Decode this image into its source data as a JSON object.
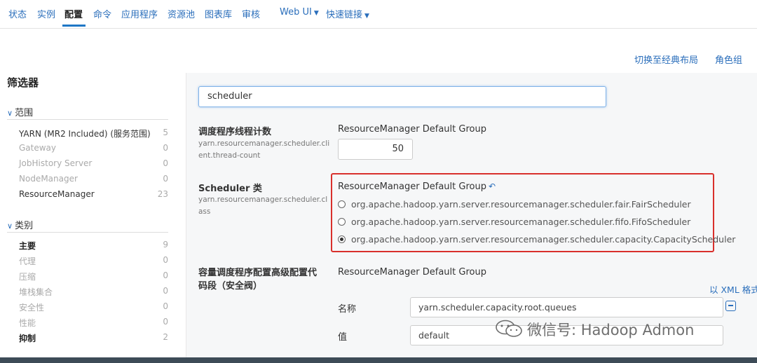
{
  "nav": {
    "items": [
      "状态",
      "实例",
      "配置",
      "命令",
      "应用程序",
      "资源池",
      "图表库",
      "审核"
    ],
    "webui": "Web UI",
    "quicklinks": "快速链接"
  },
  "toplinks": {
    "classic": "切换至经典布局",
    "role_groups": "角色组"
  },
  "sidebar": {
    "title": "筛选器",
    "scope": {
      "label": "范围",
      "items": [
        {
          "label": "YARN (MR2 Included) (服务范围)",
          "count": "5"
        },
        {
          "label": "Gateway",
          "count": "0"
        },
        {
          "label": "JobHistory Server",
          "count": "0"
        },
        {
          "label": "NodeManager",
          "count": "0"
        },
        {
          "label": "ResourceManager",
          "count": "23"
        }
      ]
    },
    "category": {
      "label": "类别",
      "items": [
        {
          "label": "主要",
          "count": "9"
        },
        {
          "label": "代理",
          "count": "0"
        },
        {
          "label": "压缩",
          "count": "0"
        },
        {
          "label": "堆栈集合",
          "count": "0"
        },
        {
          "label": "安全性",
          "count": "0"
        },
        {
          "label": "性能",
          "count": "0"
        },
        {
          "label": "抑制",
          "count": "2"
        }
      ]
    }
  },
  "search": {
    "value": "scheduler"
  },
  "properties": {
    "thread_count": {
      "label": "调度程序线程计数",
      "key_line1": "yarn.resourcemanager.scheduler.cli",
      "key_line2": "ent.thread-count",
      "group": "ResourceManager Default Group",
      "value": "50"
    },
    "scheduler_class": {
      "label": "Scheduler 类",
      "key_line1": "yarn.resourcemanager.scheduler.cl",
      "key_line2": "ass",
      "group": "ResourceManager Default Group",
      "options": [
        "org.apache.hadoop.yarn.server.resourcemanager.scheduler.fair.FairScheduler",
        "org.apache.hadoop.yarn.server.resourcemanager.scheduler.fifo.FifoScheduler",
        "org.apache.hadoop.yarn.server.resourcemanager.scheduler.capacity.CapacityScheduler"
      ],
      "selected": "org.apache.hadoop.yarn.server.resourcemanager.scheduler.capacity.CapacityScheduler"
    },
    "capacity_snippet": {
      "label_line1": "容量调度程序配置高级配置代",
      "label_line2": "码段（安全阀）",
      "group": "ResourceManager Default Group",
      "xml_link": "以 XML 格式",
      "name_label": "名称",
      "name_value": "yarn.scheduler.capacity.root.queues",
      "value_label": "值",
      "value_value": "default"
    }
  },
  "watermark": "微信号: Hadoop Admon",
  "colors": {
    "link": "#2a6ebb",
    "highlight_border": "#d9302c",
    "bottom_bar": "#3d4b57"
  }
}
